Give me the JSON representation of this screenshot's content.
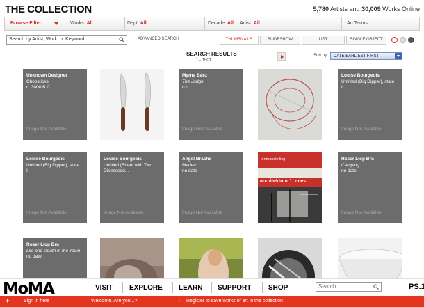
{
  "header": {
    "title": "THE COLLECTION",
    "artists_count": "5,780",
    "artists_label": "Artists and",
    "works_count": "30,009",
    "works_label": "Works Online"
  },
  "filters": {
    "browse_label": "Browse Filter",
    "works_label": "Works:",
    "works_value": "All",
    "dept_label": "Dept:",
    "dept_value": "All",
    "decade_label": "Decade:",
    "decade_value": "All",
    "artist_label": "Artist:",
    "artist_value": "All",
    "art_terms": "Art Terms"
  },
  "search": {
    "placeholder": "Search by Artist, Work, or Keyword",
    "advanced": "ADVANCED SEARCH"
  },
  "view_tabs": [
    "THUMBNAILS",
    "SLIDESHOW",
    "LIST",
    "SINGLE OBJECT"
  ],
  "active_tab": "THUMBNAILS",
  "results": {
    "label": "SEARCH RESULTS",
    "range": "1 - 1501",
    "sort_label": "Sort by:",
    "sort_value": "DATE EARLIEST FIRST"
  },
  "tiles": [
    {
      "artist": "Unknown Designer",
      "work": "Chopsticks",
      "italic": false,
      "date": "c. 3000 B.C.",
      "na": "Image Not Available",
      "kind": "gray"
    },
    {
      "kind": "knives"
    },
    {
      "artist": "Myrna Báez",
      "work": "The Judge",
      "italic": true,
      "date": "n.d.",
      "na": "Image Not Available",
      "kind": "gray"
    },
    {
      "kind": "drawing"
    },
    {
      "artist": "Louise Bourgeois",
      "work": "Untitled (Big Dipper), state",
      "italic": false,
      "date": "I",
      "na": "Image Not Available",
      "kind": "gray"
    },
    {
      "artist": "Louise Bourgeois",
      "work": "Untitled (Big Dipper), state",
      "italic": false,
      "date": "II",
      "na": "Image Not Available",
      "kind": "gray"
    },
    {
      "artist": "Louise Bourgeois",
      "work": "Untitled (Sheet with Two",
      "italic": false,
      "date": "Distressed...",
      "na": "Image Not Available",
      "kind": "gray"
    },
    {
      "artist": "Angel Bracho",
      "work": "Madero",
      "italic": true,
      "date": "no date",
      "na": "Image Not Available",
      "kind": "gray"
    },
    {
      "kind": "poster",
      "poster_top": "tentoonstelling",
      "poster_mid": "architektuur 1. mies"
    },
    {
      "artist": "Roser Llop Bru",
      "work": "Camping",
      "italic": true,
      "date": "no date",
      "na": "Image Not Available",
      "kind": "gray"
    },
    {
      "artist": "Roser Llop Bru",
      "work": "Life and Death in the Town",
      "italic": true,
      "date": "no date",
      "na": "",
      "kind": "gray"
    },
    {
      "kind": "photo"
    },
    {
      "kind": "painting"
    },
    {
      "kind": "bw"
    },
    {
      "kind": "bowl"
    }
  ],
  "footer": {
    "logo": "MoMA",
    "nav": [
      "VISIT",
      "EXPLORE",
      "LEARN",
      "SUPPORT",
      "SHOP"
    ],
    "search_placeholder": "Search",
    "ps1": "PS.1",
    "sign_in": "Sign in here",
    "welcome": "Welcome. Are you...?",
    "register": "Register to save works of art in the collection"
  },
  "colors": {
    "accent": "#d52b1e",
    "tile_gray": "#6c6c6c",
    "red_bar": "#e5351f"
  }
}
